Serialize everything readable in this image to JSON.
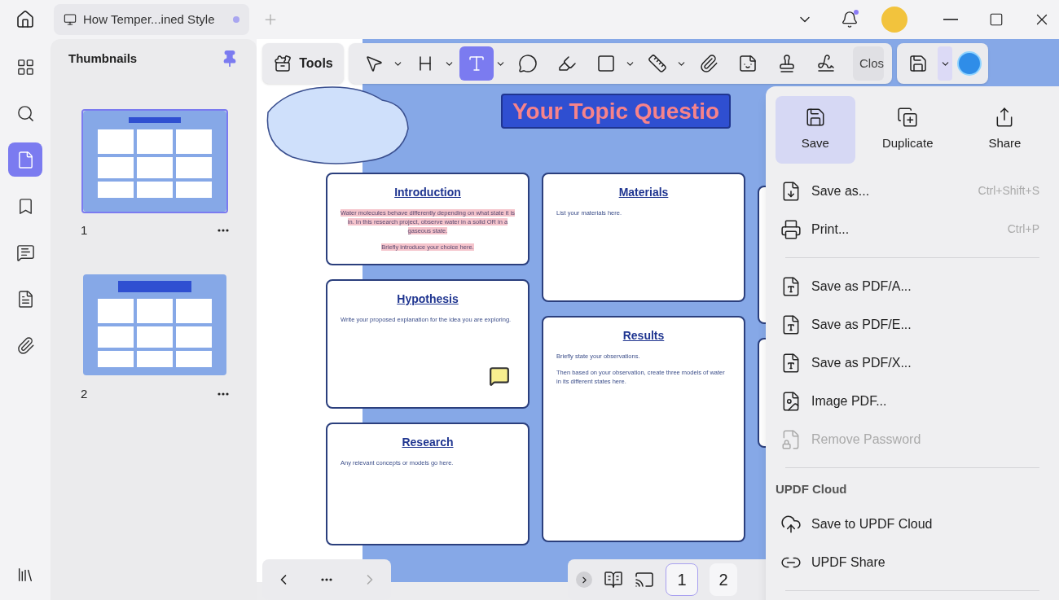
{
  "tab": {
    "title": "How Temper...ined Style",
    "modified": true
  },
  "notifications": {
    "unread": true
  },
  "rail": [
    {
      "selected": false
    },
    {
      "selected": false
    },
    {
      "selected": true
    },
    {
      "selected": false
    },
    {
      "selected": false
    },
    {
      "selected": false
    },
    {
      "selected": false
    }
  ],
  "thumbnails": {
    "title": "Thumbnails",
    "pinned": true,
    "pages": [
      {
        "label": "1",
        "selected": true
      },
      {
        "label": "2",
        "selected": false
      }
    ]
  },
  "toolbar": {
    "tools_label": "Tools",
    "items": [
      {
        "selected": false,
        "dropdown": true
      },
      {
        "selected": false,
        "dropdown": true
      },
      {
        "selected": true,
        "dropdown": true
      },
      {
        "selected": false,
        "dropdown": false
      },
      {
        "selected": false,
        "dropdown": false
      },
      {
        "selected": false,
        "dropdown": true
      },
      {
        "selected": false,
        "dropdown": true
      },
      {
        "selected": false,
        "dropdown": false
      },
      {
        "selected": false,
        "dropdown": false
      },
      {
        "selected": false,
        "dropdown": false
      },
      {
        "selected": false,
        "dropdown": false
      }
    ],
    "close_label": "Clos"
  },
  "document": {
    "title": "Your Topic Questio",
    "columns": [
      [
        {
          "heading": "Introduction",
          "highlighted": true,
          "comment": false,
          "paragraphs": [
            "Water molecules behave differently depending on what state it is in. In this research project, observe water in a solid OR in a gaseous state.",
            "Briefly introduce your choice here."
          ]
        },
        {
          "heading": "Hypothesis",
          "highlighted": false,
          "comment": true,
          "paragraphs": [
            "Write your proposed explanation for the idea you are exploring."
          ]
        },
        {
          "heading": "Research",
          "highlighted": false,
          "comment": false,
          "paragraphs": [
            "Any relevant concepts or models go here."
          ]
        }
      ],
      [
        {
          "heading": "Materials",
          "highlighted": false,
          "comment": false,
          "paragraphs": [
            "List your materials here."
          ]
        },
        {
          "heading": "Results",
          "highlighted": false,
          "comment": false,
          "paragraphs": [
            "Briefly state your observations.",
            "Then based on your observation, create three models of water in its different states here."
          ]
        }
      ]
    ]
  },
  "pager": {
    "pages": [
      {
        "label": "1",
        "selected": true
      },
      {
        "label": "2",
        "selected": false
      }
    ]
  },
  "menu": {
    "actions": [
      {
        "label": "Save",
        "selected": true
      },
      {
        "label": "Duplicate",
        "selected": false
      },
      {
        "label": "Share",
        "selected": false
      }
    ],
    "items": [
      {
        "kind": "item",
        "label": "Save as...",
        "shortcut": "Ctrl+Shift+S",
        "disabled": false
      },
      {
        "kind": "item",
        "label": "Print...",
        "shortcut": "Ctrl+P",
        "disabled": false
      },
      {
        "kind": "divider"
      },
      {
        "kind": "item",
        "label": "Save as PDF/A...",
        "disabled": false
      },
      {
        "kind": "item",
        "label": "Save as PDF/E...",
        "disabled": false
      },
      {
        "kind": "item",
        "label": "Save as PDF/X...",
        "disabled": false
      },
      {
        "kind": "item",
        "label": "Image PDF...",
        "disabled": false
      },
      {
        "kind": "item",
        "label": "Remove Password",
        "disabled": true
      },
      {
        "kind": "divider"
      },
      {
        "kind": "header",
        "label": "UPDF Cloud"
      },
      {
        "kind": "item",
        "label": "Save to UPDF Cloud",
        "disabled": false
      },
      {
        "kind": "item",
        "label": "UPDF Share",
        "disabled": false
      },
      {
        "kind": "divider"
      }
    ]
  }
}
